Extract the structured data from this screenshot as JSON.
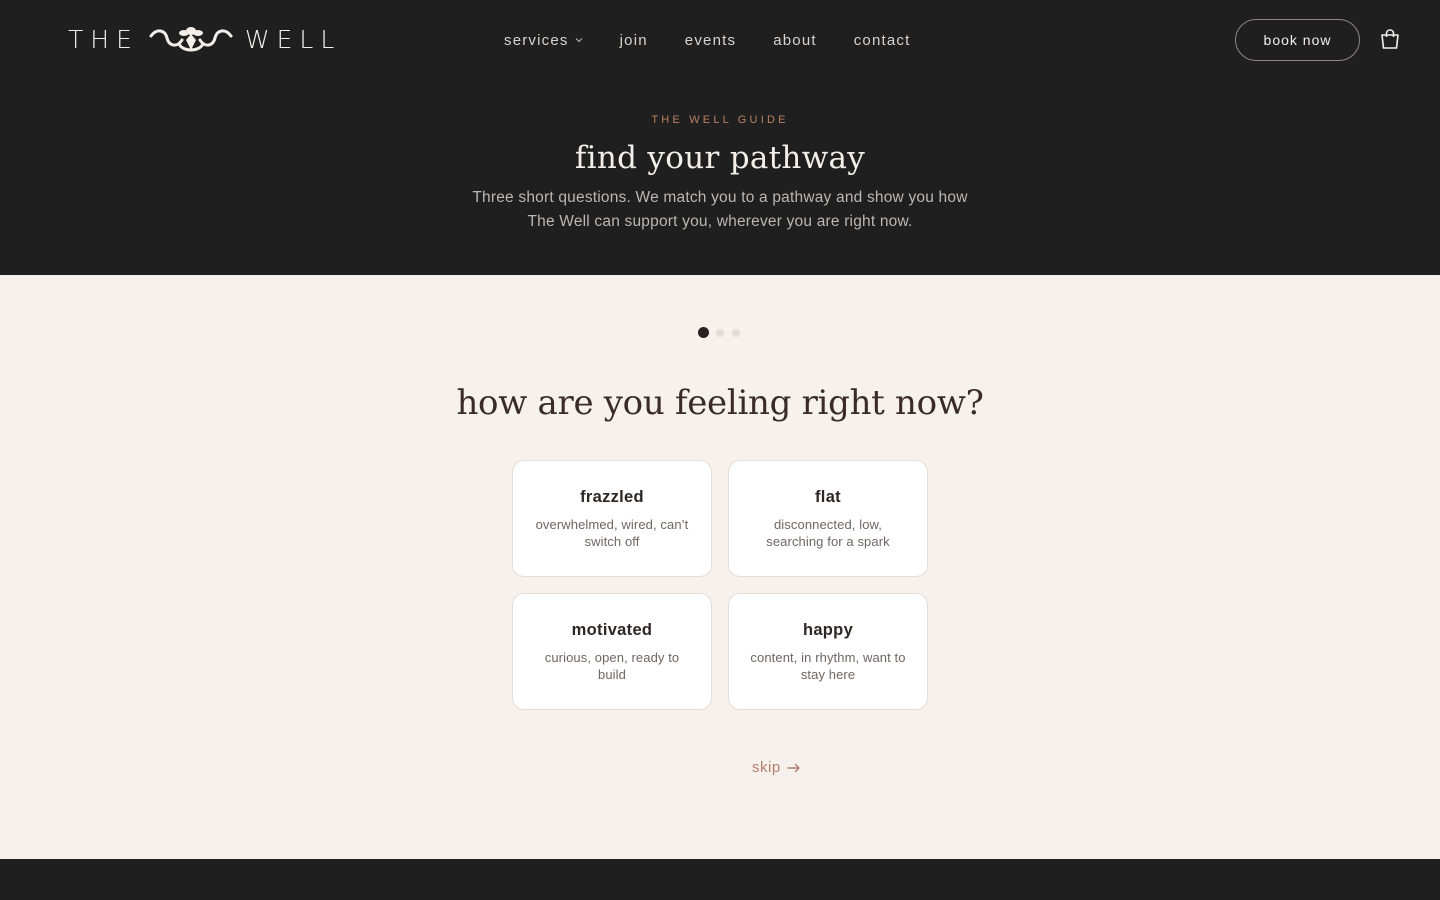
{
  "brand": {
    "word_left": "THE",
    "word_right": "WELL",
    "logo_icon": "ornament-logo-icon"
  },
  "nav": {
    "items": [
      {
        "label": "services",
        "has_dropdown": true
      },
      {
        "label": "join"
      },
      {
        "label": "events"
      },
      {
        "label": "about"
      },
      {
        "label": "contact"
      }
    ],
    "book_label": "book now",
    "cart_icon": "shopping-bag-icon"
  },
  "hero": {
    "eyebrow": "THE WELL GUIDE",
    "title": "find your pathway",
    "subtitle_line1": "Three short questions. We match you to a pathway and show you how",
    "subtitle_line2": "The Well can support you, wherever you are right now."
  },
  "quiz": {
    "step_current": 1,
    "step_total": 3,
    "question": "how are you feeling right now?",
    "options": [
      {
        "title": "frazzled",
        "desc": "overwhelmed, wired, can’t switch off"
      },
      {
        "title": "flat",
        "desc": "disconnected, low, searching for a spark"
      },
      {
        "title": "motivated",
        "desc": "curious, open, ready to build"
      },
      {
        "title": "happy",
        "desc": "content, in rhythm, want to stay here"
      }
    ],
    "skip_label": "skip",
    "skip_icon": "arrow-right-icon"
  },
  "colors": {
    "dark_bg": "#1f1f1f",
    "light_bg": "#f6f1ec",
    "accent": "#b98064",
    "card_bg": "#ffffff"
  }
}
